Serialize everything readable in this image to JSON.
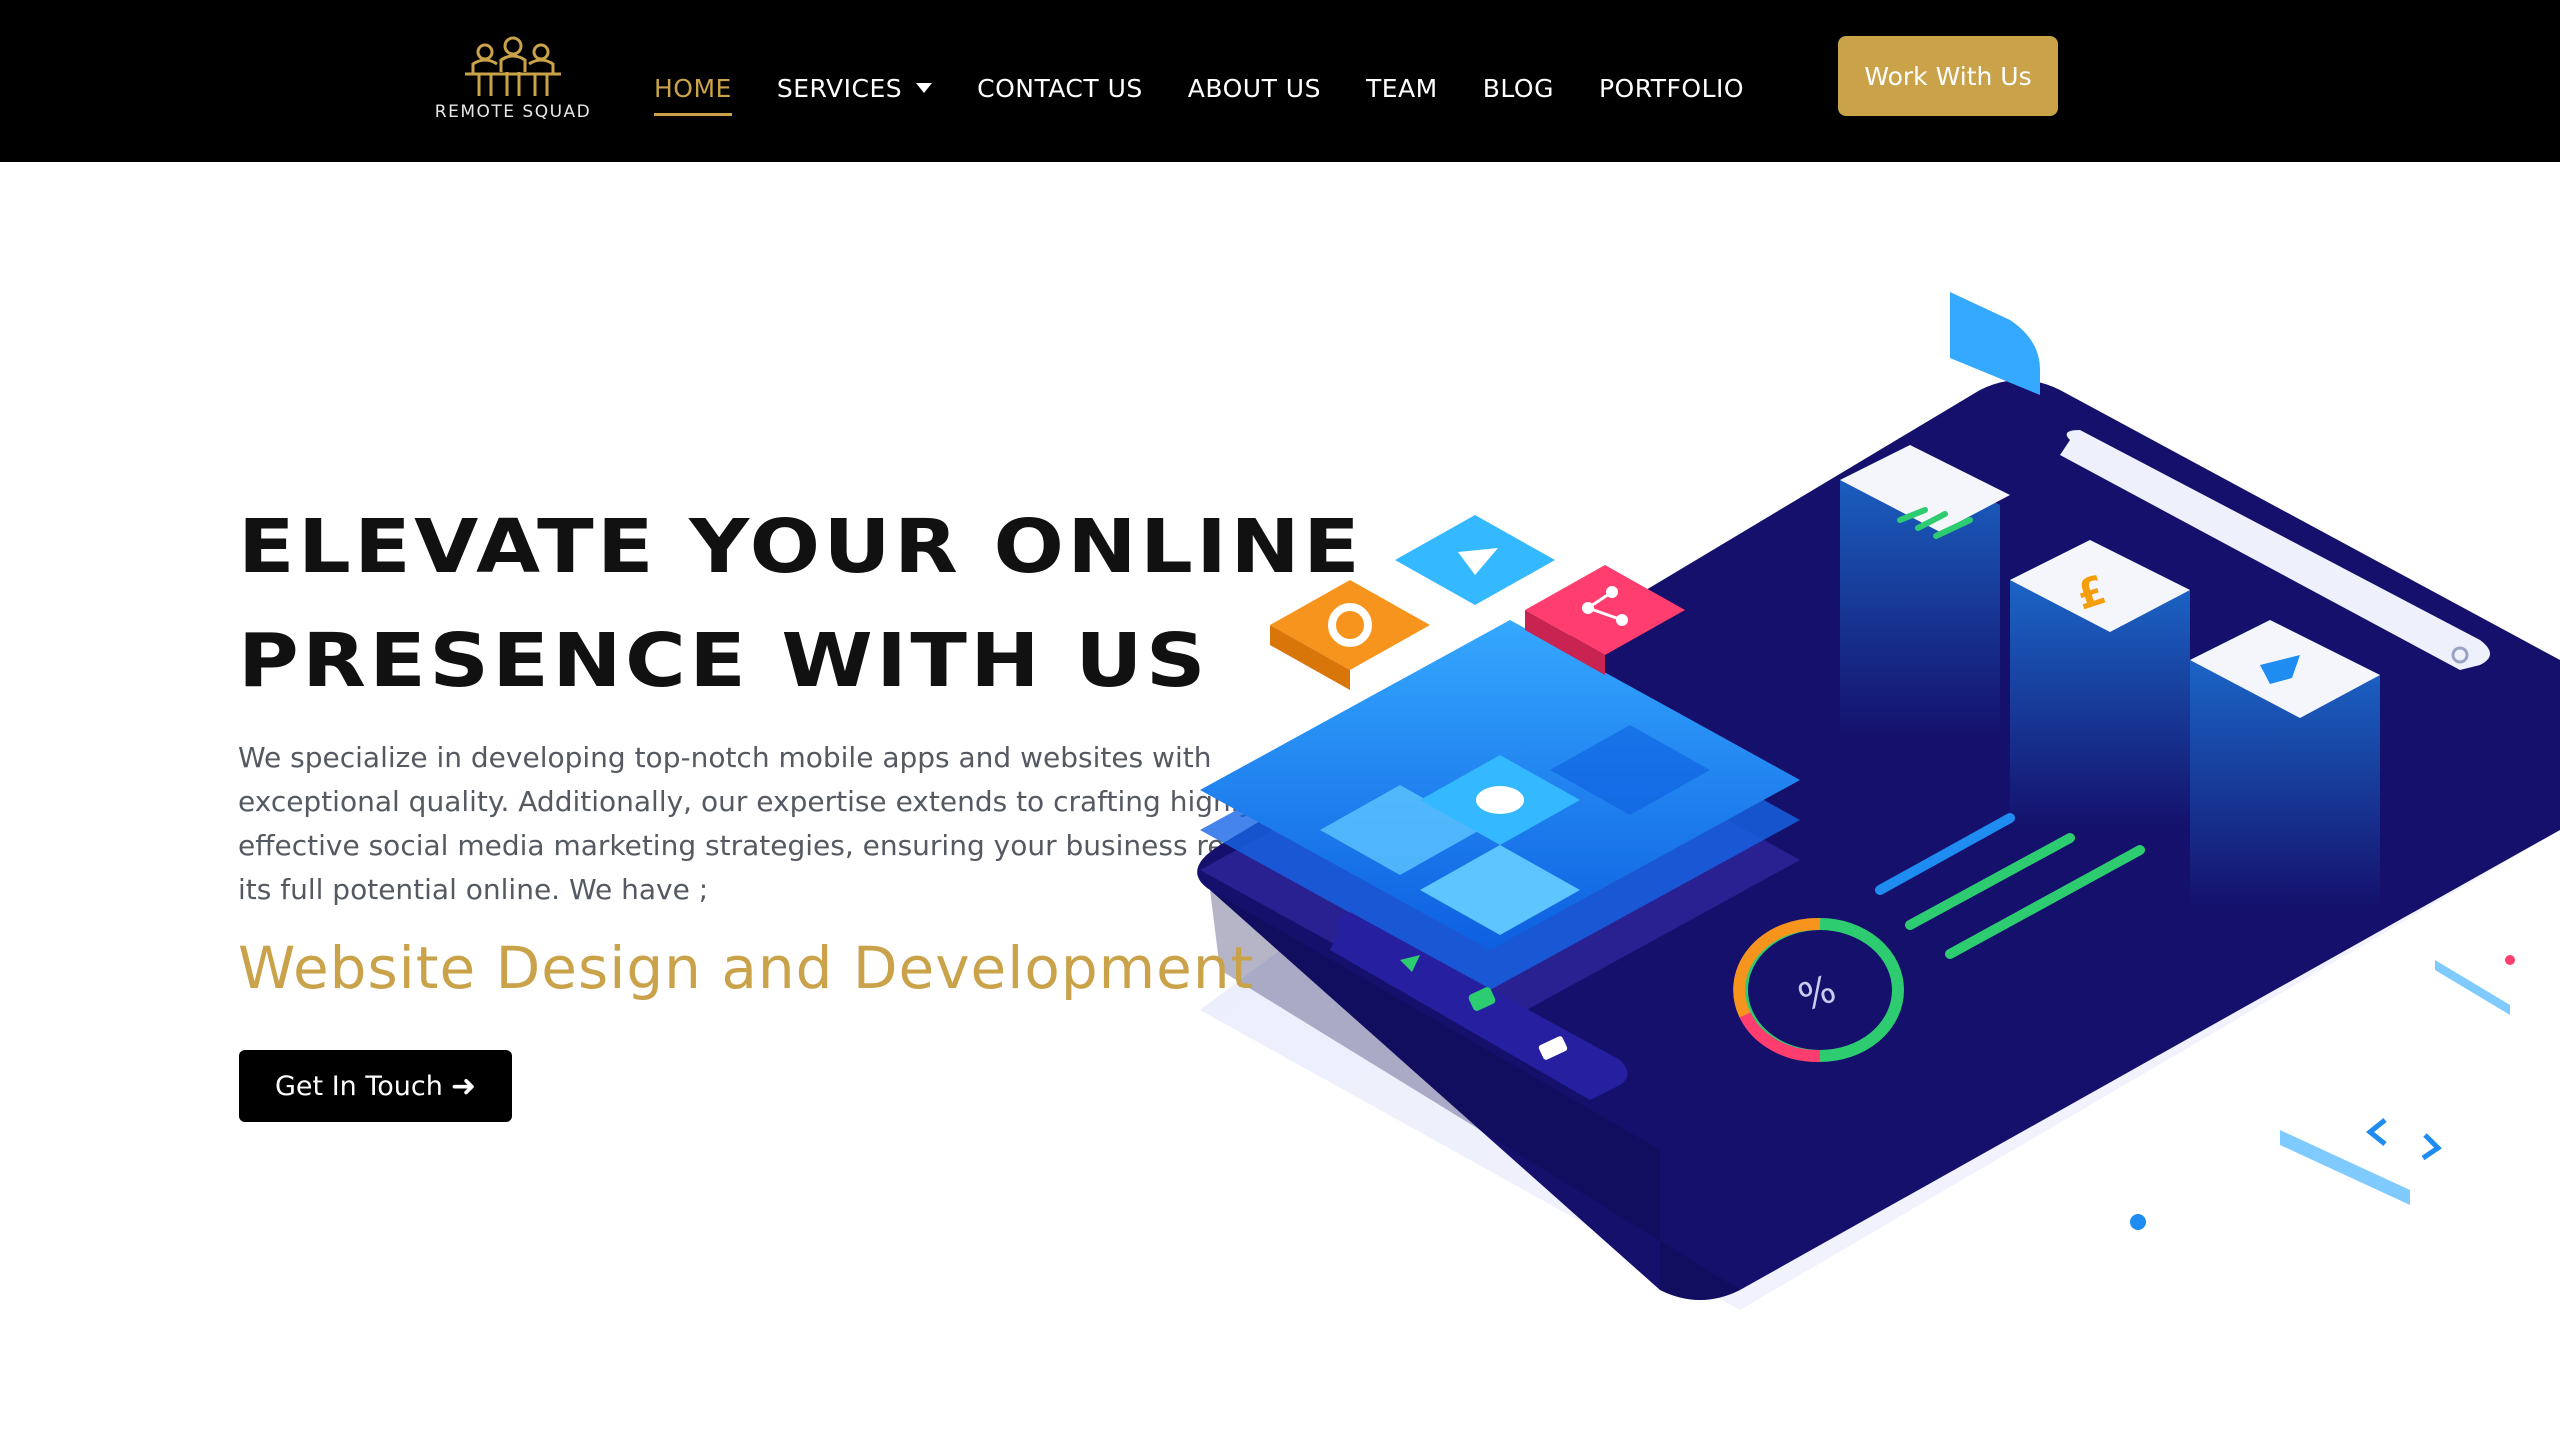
{
  "brand": {
    "name": "REMOTE SQUAD",
    "logo_icon": "team-people-icon"
  },
  "nav": {
    "items": [
      {
        "label": "HOME",
        "active": true
      },
      {
        "label": "SERVICES",
        "has_dropdown": true
      },
      {
        "label": "CONTACT US"
      },
      {
        "label": "ABOUT US"
      },
      {
        "label": "TEAM"
      },
      {
        "label": "BLOG"
      },
      {
        "label": "PORTFOLIO"
      }
    ],
    "cta_label": "Work With Us"
  },
  "hero": {
    "title_line1": "ELEVATE YOUR ONLINE",
    "title_line2": "PRESENCE WITH US",
    "description": "We specialize in developing top-notch mobile apps and websites with exceptional quality. Additionally, our expertise extends to crafting highly effective social media marketing strategies, ensuring your business reaches its full potential online. We have ;",
    "subtitle": "Website Design and Development",
    "cta_label": "Get In Touch",
    "cta_icon": "arrow-right-icon"
  },
  "colors": {
    "header_bg": "#000000",
    "accent_gold": "#c9a24a",
    "text_dark": "#111111",
    "text_body": "#555a62",
    "illus_navy": "#14106b",
    "illus_blue": "#1e8cf0"
  }
}
